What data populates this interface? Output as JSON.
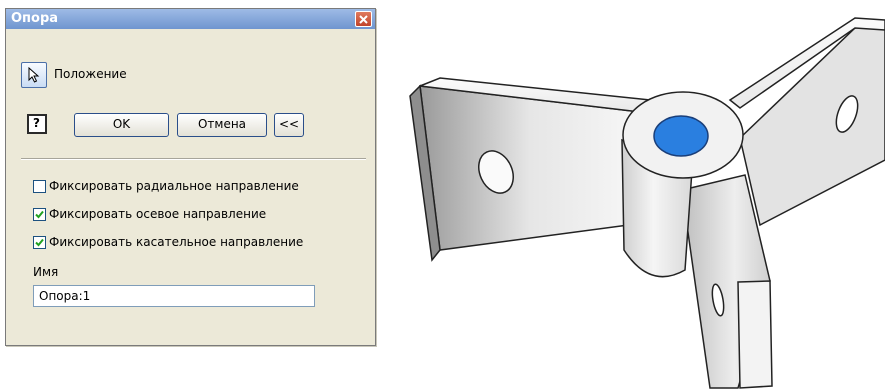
{
  "dialog": {
    "title": "Опора",
    "position_label": "Положение",
    "help_label": "?",
    "ok_label": "OK",
    "cancel_label": "Отмена",
    "expand_label": "<<",
    "options": [
      {
        "label": "Фиксировать радиальное направление",
        "checked": false
      },
      {
        "label": "Фиксировать осевое направление",
        "checked": true
      },
      {
        "label": "Фиксировать касательное направление",
        "checked": true
      }
    ],
    "name_label": "Имя",
    "name_value": "Опора:1"
  },
  "icons": {
    "close": "close-icon",
    "select": "cursor-arrow-icon",
    "help": "help-icon",
    "check": "checkmark-icon"
  },
  "colors": {
    "title_bar": "#6f95cf",
    "dialog_bg": "#ece9d8",
    "check_green": "#21a121",
    "selected_face": "#2a7fe0"
  }
}
